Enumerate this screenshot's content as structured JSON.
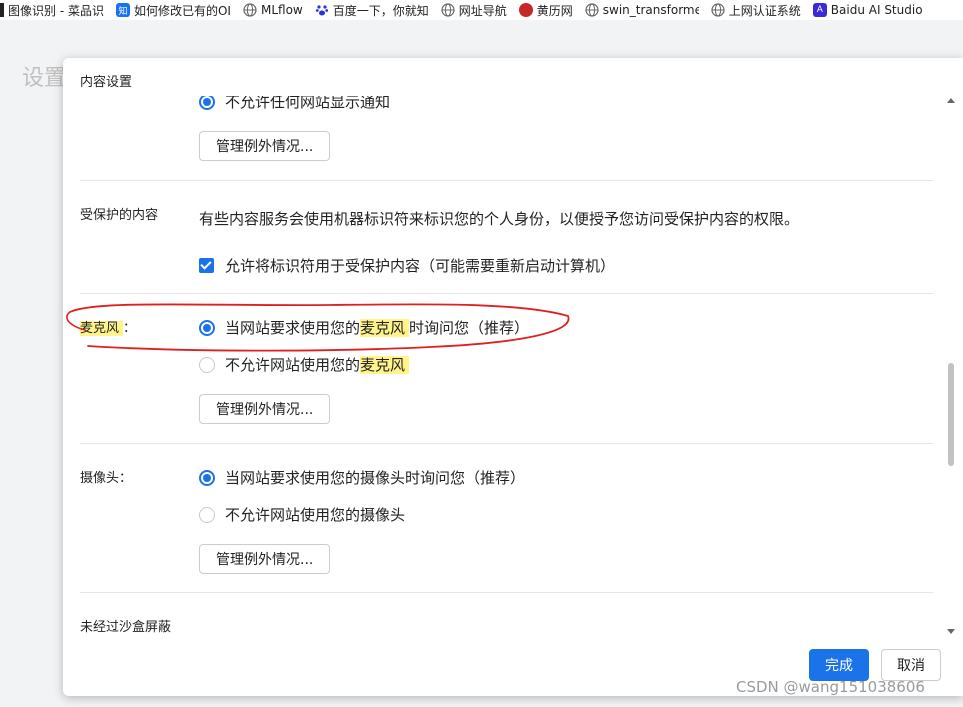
{
  "bookmarks": [
    {
      "label": "图像识别 - 菜品识",
      "icon": "bookmark-icon",
      "color": "#222222"
    },
    {
      "label": "如何修改已有的OI",
      "icon": "zhihu-icon",
      "color": "#1772f6"
    },
    {
      "label": "MLflow",
      "icon": "globe-icon",
      "color": "#666666"
    },
    {
      "label": "百度一下，你就知",
      "icon": "baidu-paw-icon",
      "color": "#2932e1"
    },
    {
      "label": "网址导航",
      "icon": "globe-icon",
      "color": "#666666"
    },
    {
      "label": "黄历网",
      "icon": "yinyang-icon",
      "color": "#c62828"
    },
    {
      "label": "swin_transformer",
      "icon": "globe-icon",
      "color": "#666666"
    },
    {
      "label": "上网认证系统",
      "icon": "globe-icon",
      "color": "#666666"
    },
    {
      "label": "Baidu AI Studio",
      "icon": "ai-studio-icon",
      "color": "#3b2bd6"
    }
  ],
  "background_page": {
    "title": "设置"
  },
  "dialog": {
    "title": "内容设置",
    "notifications": {
      "option_block": "不允许任何网站显示通知",
      "manage_button": "管理例外情况..."
    },
    "protected_content": {
      "label": "受保护的内容",
      "description": "有些内容服务会使用机器标识符来标识您的个人身份，以便授予您访问受保护内容的权限。",
      "checkbox_label": "允许将标识符用于受保护内容（可能需要重新启动计算机）",
      "checked": true
    },
    "microphone": {
      "label": "麦克风",
      "label_suffix": "：",
      "option_ask_prefix": "当网站要求使用您的",
      "option_ask_highlight": "麦克风",
      "option_ask_suffix": "时询问您（推荐）",
      "option_block_prefix": "不允许网站使用您的",
      "option_block_highlight": "麦克风",
      "selected": "ask",
      "manage_button": "管理例外情况..."
    },
    "camera": {
      "label": "摄像头：",
      "option_ask": "当网站要求使用您的摄像头时询问您（推荐）",
      "option_block": "不允许网站使用您的摄像头",
      "selected": "ask",
      "manage_button": "管理例外情况..."
    },
    "unsandboxed": {
      "label": "未经过沙盒屏蔽"
    },
    "done_button": "完成",
    "cancel_button": "取消"
  },
  "colors": {
    "accent": "#1a73e8",
    "highlight": "#fff38a",
    "annotation": "#e02020"
  },
  "watermark": "CSDN @wang151038606"
}
